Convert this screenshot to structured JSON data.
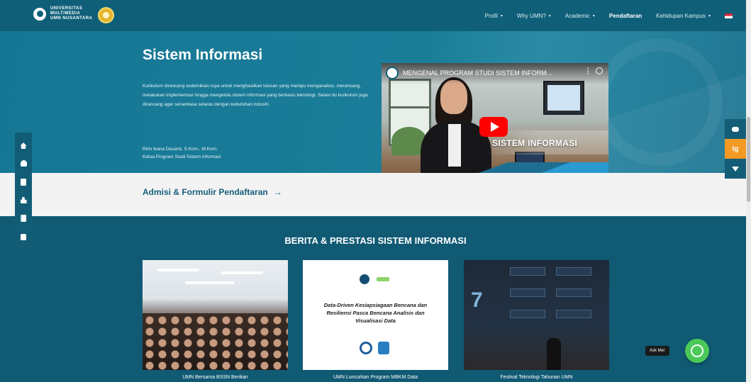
{
  "navbar": {
    "logo_lines": [
      "UNIVERSITAS",
      "MULTIMEDIA",
      "UMN NUSANTARA"
    ],
    "menu": [
      {
        "label": "Profil",
        "caret": true,
        "active": false
      },
      {
        "label": "Why UMN?",
        "caret": true,
        "active": false
      },
      {
        "label": "Academic",
        "caret": true,
        "active": false
      },
      {
        "label": "Pendaftaran",
        "caret": false,
        "active": true
      },
      {
        "label": "Kehidupan Kampus",
        "caret": true,
        "active": false
      }
    ],
    "language_icon": "indonesia-flag-icon"
  },
  "hero": {
    "title": "Sistem Informasi",
    "description": "Kurikulum dirancang sedemikian rupa untuk menghasilkan lulusan yang mampu menganalisis, merancang, melakukan implementasi hingga mengelola sistem informasi yang berbasis teknologi. Selain itu kurikulum juga dirancang agar senantiasa selaras dengan kebutuhan industri.",
    "person_name": "Ririn Ikana Desanti, S.Kom., M.Kom.",
    "person_role": "Ketua Program Studi Sistem Informasi"
  },
  "video": {
    "title": "MENGENAL PROGRAM STUDI SISTEM INFORM...",
    "overlay_text": "SISTEM INFORMASI",
    "play_icon": "youtube-play-icon"
  },
  "admisi": {
    "label": "Admisi & Formulir Pendaftaran",
    "arrow": "→"
  },
  "news": {
    "heading": "BERITA & PRESTASI SISTEM INFORMASI",
    "cards": [
      {
        "caption": "UMN Bersama BSSN Berikan"
      },
      {
        "caption": "UMN Luncurkan Program MBKM Data",
        "image_text": "Data-Driven Kesiapsiagaan Bencana dan Resiliensi Pasca Bencana Analisis dan Visualisasi Data"
      },
      {
        "caption": "Festival Teknologi Tahunan UMN",
        "image_number": "7"
      }
    ]
  },
  "side_left_icons": [
    "home-icon",
    "users-icon",
    "id-card-icon",
    "people-icon",
    "book-icon",
    "lock-icon"
  ],
  "side_right": {
    "icons": [
      "chat-icon",
      "sign-icon",
      "down-arrow-icon"
    ],
    "middle_label": "Ig"
  },
  "whatsapp": {
    "label": "Ask Me!",
    "icon": "whatsapp-icon"
  },
  "colors": {
    "nav_bg": "#0f5f79",
    "hero_bg": "#1a7d98",
    "news_bg": "#105a74",
    "accent_orange": "#f39a24",
    "whatsapp_green": "#4ac959"
  }
}
